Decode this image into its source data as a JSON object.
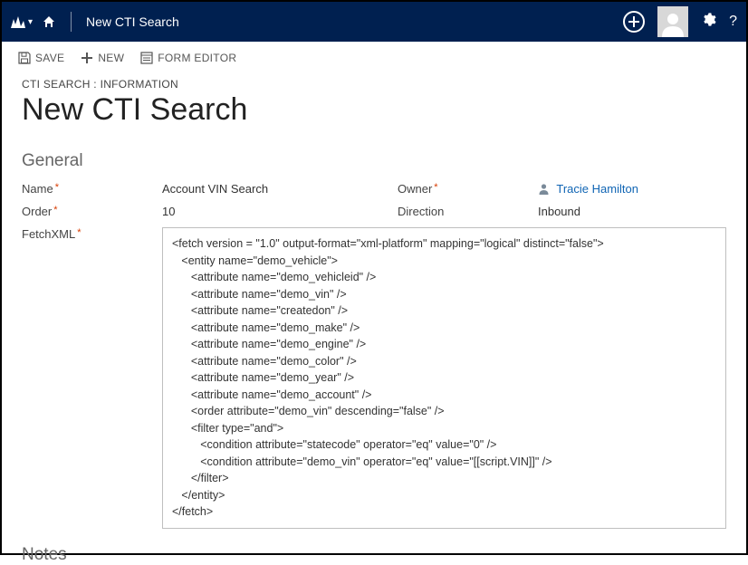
{
  "topbar": {
    "title": "New CTI Search"
  },
  "commands": {
    "save": "SAVE",
    "new": "NEW",
    "formEditor": "FORM EDITOR"
  },
  "breadcrumb": "CTI SEARCH : INFORMATION",
  "pageTitle": "New CTI Search",
  "sections": {
    "general": "General",
    "notes": "Notes"
  },
  "fields": {
    "nameLabel": "Name",
    "nameValue": "Account VIN Search",
    "ownerLabel": "Owner",
    "ownerValue": "Tracie Hamilton",
    "orderLabel": "Order",
    "orderValue": "10",
    "directionLabel": "Direction",
    "directionValue": "Inbound",
    "fetchLabel": "FetchXML",
    "fetchValue": "<fetch version = \"1.0\" output-format=\"xml-platform\" mapping=\"logical\" distinct=\"false\">\n   <entity name=\"demo_vehicle\">\n      <attribute name=\"demo_vehicleid\" />\n      <attribute name=\"demo_vin\" />\n      <attribute name=\"createdon\" />\n      <attribute name=\"demo_make\" />\n      <attribute name=\"demo_engine\" />\n      <attribute name=\"demo_color\" />\n      <attribute name=\"demo_year\" />\n      <attribute name=\"demo_account\" />\n      <order attribute=\"demo_vin\" descending=\"false\" />\n      <filter type=\"and\">\n         <condition attribute=\"statecode\" operator=\"eq\" value=\"0\" />\n         <condition attribute=\"demo_vin\" operator=\"eq\" value=\"[[script.VIN]]\" />\n      </filter>\n   </entity>\n</fetch>"
  }
}
